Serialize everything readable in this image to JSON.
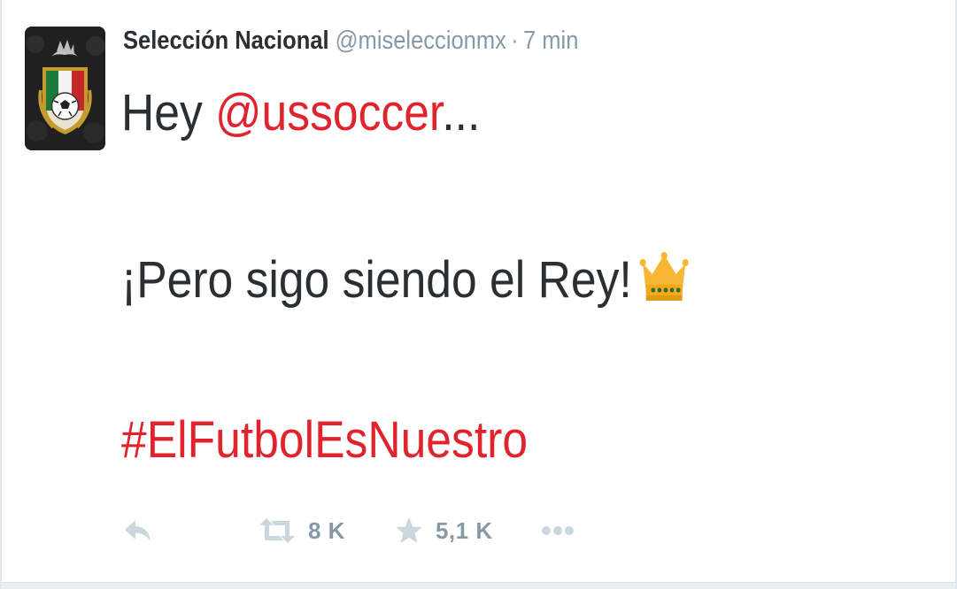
{
  "tweet": {
    "display_name": "Selección Nacional",
    "handle": "@miseleccionmx",
    "separator": "·",
    "timestamp": "7 min",
    "text": {
      "line1_prefix": "Hey ",
      "mention": "@ussoccer",
      "line1_suffix": "...",
      "line2": "¡Pero sigo siendo el Rey!",
      "hashtag": "#ElFutbolEsNuestro"
    },
    "crown_emoji_icon": "crown-emoji"
  },
  "actions": {
    "reply_icon": "reply-icon",
    "retweet_icon": "retweet-icon",
    "retweet_count": "8 K",
    "favorite_icon": "star-icon",
    "favorite_count": "5,1 K",
    "more_icon": "more-dots-icon"
  },
  "colors": {
    "accent_red": "#e0242e",
    "text_dark": "#292f33",
    "text_muted": "#8899a6",
    "icon_gray": "#ccd6dd"
  }
}
